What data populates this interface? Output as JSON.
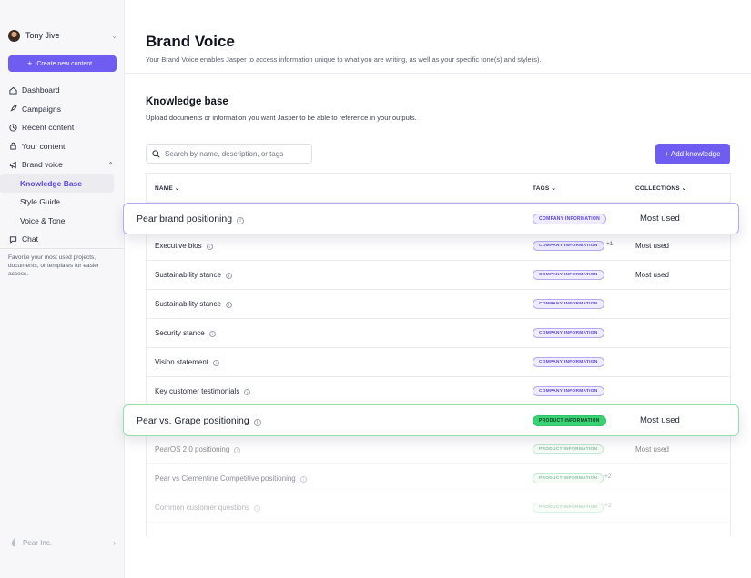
{
  "sidebar": {
    "user_name": "Tony Jive",
    "create_label": "Create new content...",
    "nav": [
      {
        "label": "Dashboard",
        "icon": "home-icon"
      },
      {
        "label": "Campaigns",
        "icon": "rocket-icon"
      },
      {
        "label": "Recent content",
        "icon": "clock-icon"
      },
      {
        "label": "Your content",
        "icon": "lock-icon"
      },
      {
        "label": "Brand voice",
        "icon": "megaphone-icon"
      },
      {
        "label": "Knowledge Base"
      },
      {
        "label": "Style Guide"
      },
      {
        "label": "Voice & Tone"
      },
      {
        "label": "Chat",
        "icon": "chat-icon"
      }
    ],
    "help_text": "Favorite your most used projects, documents, or templates for easier access.",
    "org_name": "Pear Inc."
  },
  "header": {
    "title": "Brand Voice",
    "subtitle": "Your Brand Voice enables Jasper to access information unique to what you are writing, as well as your specific tone(s) and style(s)."
  },
  "knowledge": {
    "title": "Knowledge base",
    "subtitle": "Upload documents or information you want Jasper to be able to reference in your outputs.",
    "search_placeholder": "Search by name, description, or tags",
    "add_label": "+ Add knowledge",
    "columns": {
      "name": "NAME",
      "tags": "TAGS",
      "collections": "COLLECTIONS"
    },
    "rows": [
      {
        "name": "Executive bios",
        "tag": "COMPANY INFORMATION",
        "extra": "+1",
        "collection": "Most used"
      },
      {
        "name": "Sustainability stance",
        "tag": "COMPANY INFORMATION",
        "extra": "",
        "collection": "Most used"
      },
      {
        "name": "Sustainability stance",
        "tag": "COMPANY INFORMATION",
        "extra": "",
        "collection": ""
      },
      {
        "name": "Security stance",
        "tag": "COMPANY INFORMATION",
        "extra": "",
        "collection": ""
      },
      {
        "name": "Vision statement",
        "tag": "COMPANY INFORMATION",
        "extra": "",
        "collection": ""
      },
      {
        "name": "Key customer testimonials",
        "tag": "COMPANY INFORMATION",
        "extra": "",
        "collection": ""
      },
      {
        "name": "PearOS 2.0 positioning",
        "tag": "PRODUCT INFORMATION",
        "extra": "",
        "collection": "Most used"
      },
      {
        "name": "Pear vs Clementine Competitive positioning",
        "tag": "PRODUCT INFORMATION",
        "extra": "+2",
        "collection": ""
      },
      {
        "name": "Common customer questions",
        "tag": "PRODUCT INFORMATION",
        "extra": "+2",
        "collection": ""
      }
    ],
    "highlight_top": {
      "name": "Pear brand positioning",
      "tag": "COMPANY INFORMATION",
      "collection": "Most used"
    },
    "highlight_bottom": {
      "name": "Pear vs. Grape positioning",
      "tag": "PRODUCT INFORMATION",
      "collection": "Most used"
    }
  },
  "colors": {
    "accent": "#6f5cf0",
    "company_tag": "#5b45e0",
    "product_tag": "#2f8f57",
    "highlight_green": "#3ad274"
  }
}
